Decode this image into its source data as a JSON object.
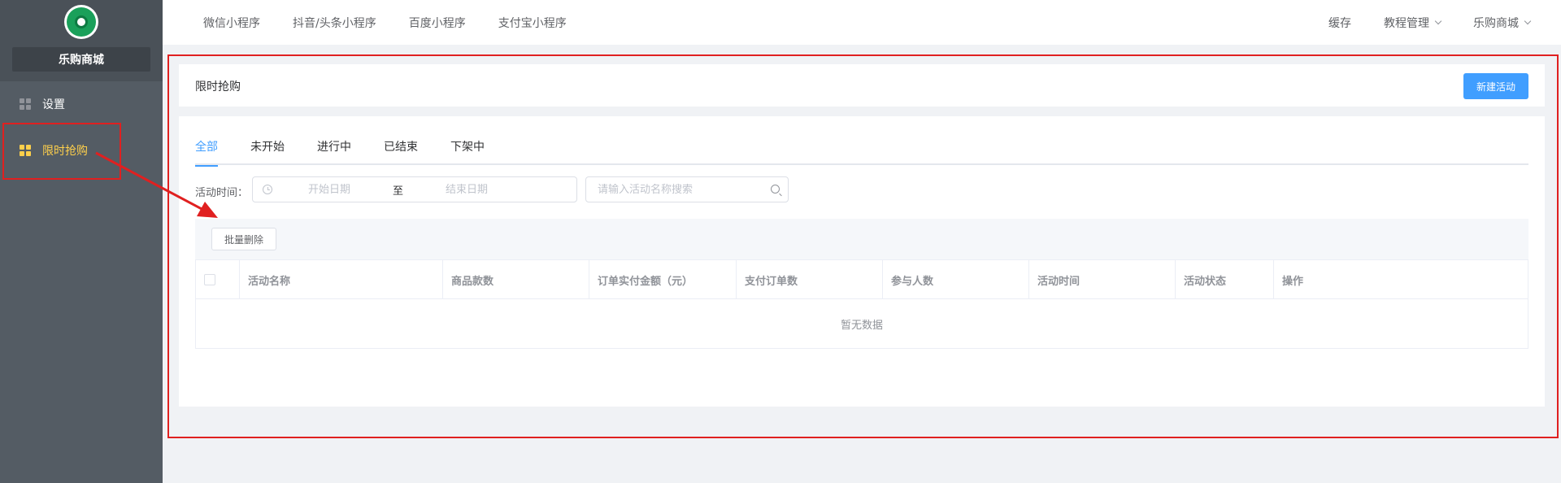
{
  "sidebar": {
    "shop_name": "乐购商城",
    "items": [
      {
        "label": "设置",
        "icon": "grid-icon"
      },
      {
        "label": "限时抢购",
        "icon": "grid-icon",
        "active": true
      }
    ]
  },
  "topnav": {
    "tabs": [
      "微信小程序",
      "抖音/头条小程序",
      "百度小程序",
      "支付宝小程序"
    ],
    "right": {
      "cache": "缓存",
      "tutorial": "教程管理",
      "shop": "乐购商城"
    }
  },
  "page": {
    "title": "限时抢购",
    "new_button": "新建活动"
  },
  "tabs": [
    "全部",
    "未开始",
    "进行中",
    "已结束",
    "下架中"
  ],
  "filter": {
    "label": "活动时间：",
    "start_placeholder": "开始日期",
    "separator": "至",
    "end_placeholder": "结束日期",
    "search_placeholder": "请输入活动名称搜索"
  },
  "toolbar": {
    "batch_delete": "批量删除"
  },
  "table": {
    "columns": [
      "活动名称",
      "商品款数",
      "订单实付金额（元）",
      "支付订单数",
      "参与人数",
      "活动时间",
      "活动状态",
      "操作"
    ],
    "empty_text": "暂无数据"
  },
  "colors": {
    "sidebar_bg": "#545c64",
    "active_menu": "#ffd04b",
    "primary": "#409eff",
    "annotation": "#e02020"
  }
}
